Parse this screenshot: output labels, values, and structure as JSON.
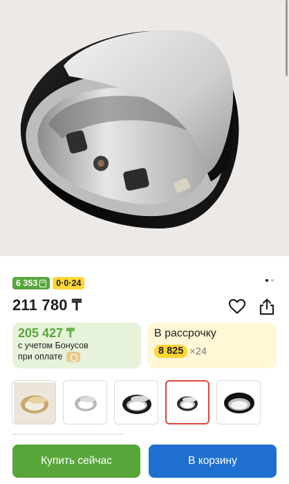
{
  "product": {
    "image_alt": "Smart ring",
    "price": "211 780 ₸",
    "badges": {
      "bonus_value": "6 353",
      "installment_code": "0·0·24"
    },
    "bonus_card": {
      "amount": "205 427 ₸",
      "line1": "с учетом Бонусов",
      "line2": "при оплате"
    },
    "installment_card": {
      "label": "В рассрочку",
      "monthly": "8 825",
      "multiplier": "×24"
    },
    "gallery": {
      "count": 5,
      "active_index": 3
    },
    "actions": {
      "buy_now": "Купить сейчас",
      "add_to_cart": "В корзину"
    },
    "icons": [
      "favorite-heart-icon",
      "share-icon"
    ],
    "colors": {
      "green": "#58a63a",
      "yellow": "#ffd633",
      "blue": "#1f6fd1",
      "active_thumb_border": "#d8473a"
    }
  }
}
